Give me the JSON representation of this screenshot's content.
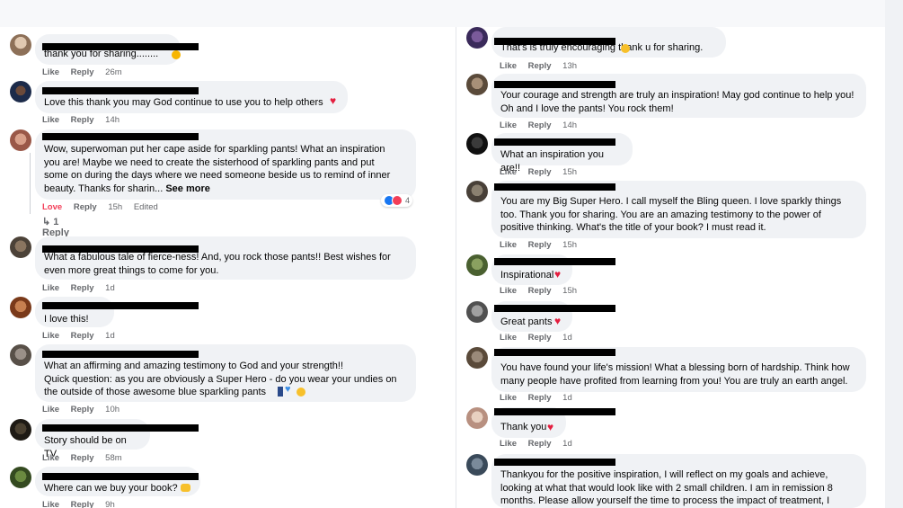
{
  "left_comments": [
    {
      "text": "thank you for sharing........",
      "actions": {
        "like": "Like",
        "reply": "Reply",
        "time": "26m"
      }
    },
    {
      "text": "Love this thank you may God continue to use you to help others",
      "actions": {
        "like": "Like",
        "reply": "Reply",
        "time": "14h"
      }
    },
    {
      "text": "Wow, superwoman put her cape aside for sparkling pants! What an inspiration\nyou are! Maybe we need to create the sisterhood of sparkling pants and put\nsome on during the days where we need someone beside us to remind of inner\nbeauty. Thanks for sharin...",
      "see_more": "See more",
      "actions": {
        "like": "Love",
        "reply": "Reply",
        "time": "15h",
        "edited": "Edited"
      },
      "reaction_count": "4",
      "replies_link": "1 Reply"
    },
    {
      "text": "What a fabulous tale of fierce-ness! And, you rock those pants!! Best wishes for\neven more great things to come for you.",
      "actions": {
        "like": "Like",
        "reply": "Reply",
        "time": "1d"
      }
    },
    {
      "text": "I love this!",
      "actions": {
        "like": "Like",
        "reply": "Reply",
        "time": "1d"
      }
    },
    {
      "text": "What an affirming and amazing testimony to God and your strength!!\nQuick question: as you are obviously a Super Hero - do you wear your undies on\nthe outside of those awesome blue sparkling pants",
      "actions": {
        "like": "Like",
        "reply": "Reply",
        "time": "10h"
      }
    },
    {
      "text": "Story should be on TV.",
      "actions": {
        "like": "Like",
        "reply": "Reply",
        "time": "58m"
      }
    },
    {
      "text": "Where can we buy your book?",
      "actions": {
        "like": "Like",
        "reply": "Reply",
        "time": "9h"
      }
    }
  ],
  "right_comments": [
    {
      "text": "That's is truly encouraging   thank u for sharing.",
      "actions": {
        "like": "Like",
        "reply": "Reply",
        "time": "13h"
      }
    },
    {
      "text": "Your courage and strength are truly an inspiration! May god continue to help you!\nOh and I love the pants! You rock them!",
      "actions": {
        "like": "Like",
        "reply": "Reply",
        "time": "14h"
      }
    },
    {
      "text": "What an inspiration you are!!",
      "actions": {
        "like": "Like",
        "reply": "Reply",
        "time": "15h"
      }
    },
    {
      "text": "You are my Big Super Hero. I call myself the Bling queen. I love sparkly things\ntoo. Thank you for sharing. You are an amazing testimony to the power of\npositive thinking. What's the title of your book? I must read it.",
      "actions": {
        "like": "Like",
        "reply": "Reply",
        "time": "15h"
      }
    },
    {
      "text": "Inspirational",
      "actions": {
        "like": "Like",
        "reply": "Reply",
        "time": "15h"
      }
    },
    {
      "text": "Great pants",
      "actions": {
        "like": "Like",
        "reply": "Reply",
        "time": "1d"
      }
    },
    {
      "text": "You have found your life's mission! What a blessing born of hardship. Think how\nmany people have profited from learning from you! You are truly an earth angel.",
      "actions": {
        "like": "Like",
        "reply": "Reply",
        "time": "1d"
      }
    },
    {
      "text": "Thank you",
      "actions": {
        "like": "Like",
        "reply": "Reply",
        "time": "1d"
      }
    },
    {
      "text": "Thankyou for the positive inspiration, I will reflect on my goals and achieve,\nlooking at what that would look like with 2 small children. I am in remission 8\nmonths. Please allow yourself the time to process the impact of treatment, I",
      "actions": {
        "like": "",
        "reply": "",
        "time": ""
      }
    }
  ],
  "colors": {
    "bubble": "#f0f2f5",
    "meta": "#65676b",
    "love": "#f33e58",
    "heart": "#e41e3f",
    "like_blue": "#1877f2"
  }
}
